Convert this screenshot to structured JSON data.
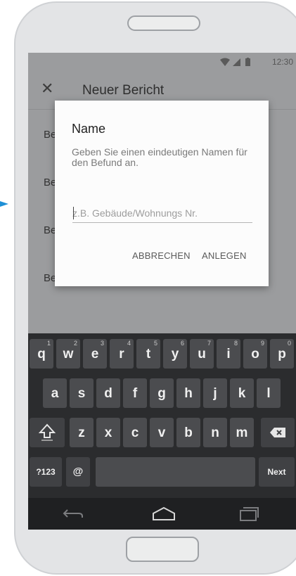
{
  "statusbar": {
    "time": "12:30"
  },
  "appbar": {
    "close_icon": "close-icon",
    "title": "Neuer Bericht"
  },
  "list": {
    "items": [
      {
        "label": "Be"
      },
      {
        "label": "Be"
      },
      {
        "label": "Be"
      },
      {
        "label": "Be"
      }
    ]
  },
  "dialog": {
    "title": "Name",
    "message": "Geben Sie einen eindeutigen Namen für den Befund an.",
    "input_placeholder": "z.B. Gebäude/Wohnungs Nr.",
    "input_value": "",
    "cancel_label": "ABBRECHEN",
    "create_label": "ANLEGEN"
  },
  "keyboard": {
    "row1": [
      {
        "label": "q",
        "hint": "1"
      },
      {
        "label": "w",
        "hint": "2"
      },
      {
        "label": "e",
        "hint": "3"
      },
      {
        "label": "r",
        "hint": "4"
      },
      {
        "label": "t",
        "hint": "5"
      },
      {
        "label": "y",
        "hint": "6"
      },
      {
        "label": "u",
        "hint": "7"
      },
      {
        "label": "i",
        "hint": "8"
      },
      {
        "label": "o",
        "hint": "9"
      },
      {
        "label": "p",
        "hint": "0"
      }
    ],
    "row2": [
      "a",
      "s",
      "d",
      "f",
      "g",
      "h",
      "j",
      "k",
      "l"
    ],
    "row3": [
      "z",
      "x",
      "c",
      "v",
      "b",
      "n",
      "m"
    ],
    "symbols_label": "?123",
    "at_label": "@",
    "period_label": ".",
    "next_label": "Next"
  },
  "colors": {
    "screen_dim": "#9b9c9e",
    "keyboard_bg": "#2b2c2e",
    "key_bg": "#4b4c4f",
    "accent_arrow": "#1e8fd6"
  }
}
